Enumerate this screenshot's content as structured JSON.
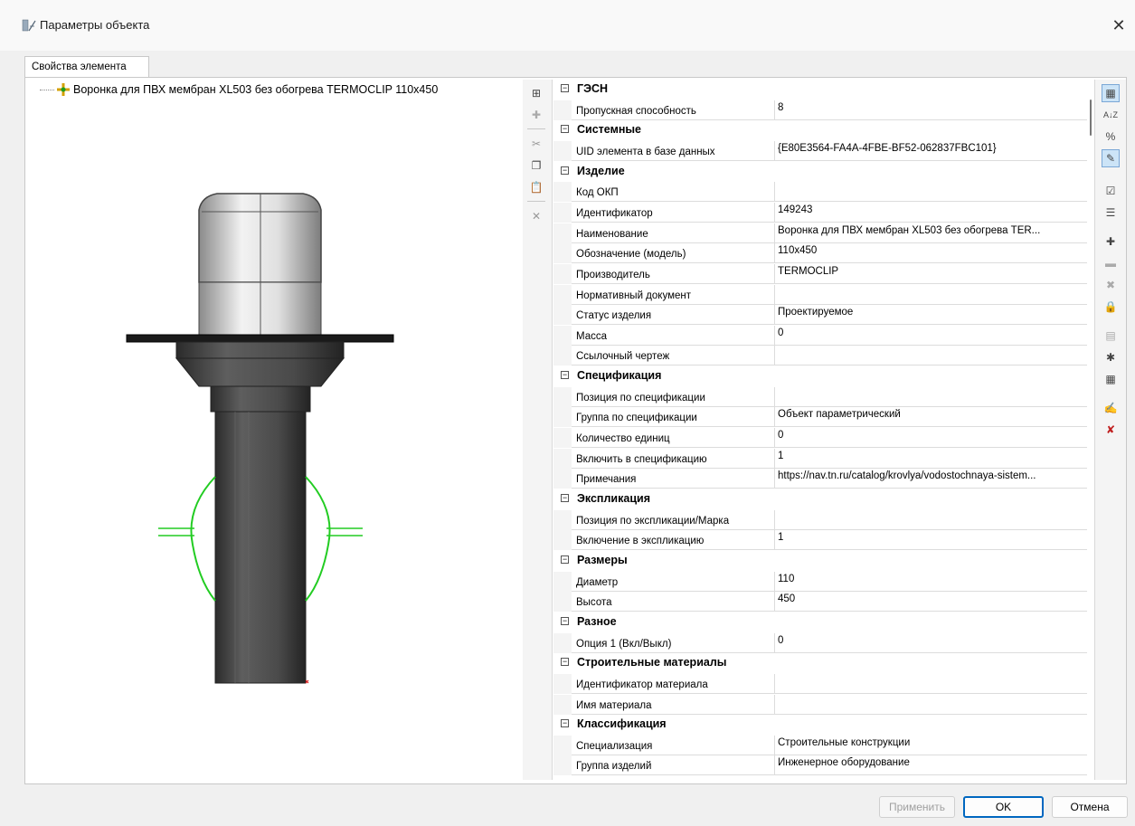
{
  "window": {
    "title": "Параметры объекта"
  },
  "tab": {
    "label": "Свойства элемента"
  },
  "tree": {
    "item_label": "Воронка для ПВХ мембран XL503 без обогрева TERMOCLIP 110x450"
  },
  "grid": {
    "rows": [
      {
        "type": "cat",
        "label": "ГЭСН"
      },
      {
        "type": "prop",
        "name": "Пропускная способность",
        "value": "8"
      },
      {
        "type": "cat",
        "label": "Системные"
      },
      {
        "type": "prop",
        "name": "UID элемента в базе данных",
        "value": "{E80E3564-FA4A-4FBE-BF52-062837FBC101}"
      },
      {
        "type": "cat",
        "label": "Изделие"
      },
      {
        "type": "prop",
        "name": "Код ОКП",
        "value": ""
      },
      {
        "type": "prop",
        "name": "Идентификатор",
        "value": "149243"
      },
      {
        "type": "prop",
        "name": "Наименование",
        "value": "Воронка для ПВХ мембран XL503 без обогрева TER..."
      },
      {
        "type": "prop",
        "name": "Обозначение (модель)",
        "value": "110x450"
      },
      {
        "type": "prop",
        "name": "Производитель",
        "value": "TERMOCLIP"
      },
      {
        "type": "prop",
        "name": "Нормативный документ",
        "value": ""
      },
      {
        "type": "prop",
        "name": "Статус изделия",
        "value": "Проектируемое"
      },
      {
        "type": "prop",
        "name": "Масса",
        "value": "0"
      },
      {
        "type": "prop",
        "name": "Ссылочный чертеж",
        "value": ""
      },
      {
        "type": "cat",
        "label": "Спецификация"
      },
      {
        "type": "prop",
        "name": "Позиция по спецификации",
        "value": ""
      },
      {
        "type": "prop",
        "name": "Группа по спецификации",
        "value": "Объект параметрический"
      },
      {
        "type": "prop",
        "name": "Количество единиц",
        "value": "0"
      },
      {
        "type": "prop",
        "name": "Включить в спецификацию",
        "value": "1"
      },
      {
        "type": "prop",
        "name": "Примечания",
        "value": "https://nav.tn.ru/catalog/krovlya/vodostochnaya-sistem..."
      },
      {
        "type": "cat",
        "label": "Экспликация"
      },
      {
        "type": "prop",
        "name": "Позиция по экспликации/Марка",
        "value": ""
      },
      {
        "type": "prop",
        "name": "Включение в экспликацию",
        "value": "1"
      },
      {
        "type": "cat",
        "label": "Размеры"
      },
      {
        "type": "prop",
        "name": "Диаметр",
        "value": "110"
      },
      {
        "type": "prop",
        "name": "Высота",
        "value": "450"
      },
      {
        "type": "cat",
        "label": "Разное"
      },
      {
        "type": "prop",
        "name": "Опция 1 (Вкл/Выкл)",
        "value": "0"
      },
      {
        "type": "cat",
        "label": "Строительные материалы"
      },
      {
        "type": "prop",
        "name": "Идентификатор материала",
        "value": ""
      },
      {
        "type": "prop",
        "name": "Имя материала",
        "value": ""
      },
      {
        "type": "cat",
        "label": "Классификация"
      },
      {
        "type": "prop",
        "name": "Специализация",
        "value": "Строительные конструкции"
      },
      {
        "type": "prop",
        "name": "Группа изделий",
        "value": "Инженерное оборудование"
      }
    ]
  },
  "right_toolbar": {
    "sort_az_label": "A↓Z",
    "pct_label": "%"
  },
  "buttons": {
    "apply": "Применить",
    "ok": "OK",
    "cancel": "Отмена"
  },
  "colors": {
    "accent": "#0067c0",
    "highlight_green": "#22cc22"
  },
  "icons": [
    "app-icon",
    "close-icon",
    "tree-item-icon",
    "add-icon",
    "paste-icon",
    "delete-icon",
    "categorized-icon",
    "sort-alpha-icon",
    "edit-icon",
    "lock-icon"
  ]
}
